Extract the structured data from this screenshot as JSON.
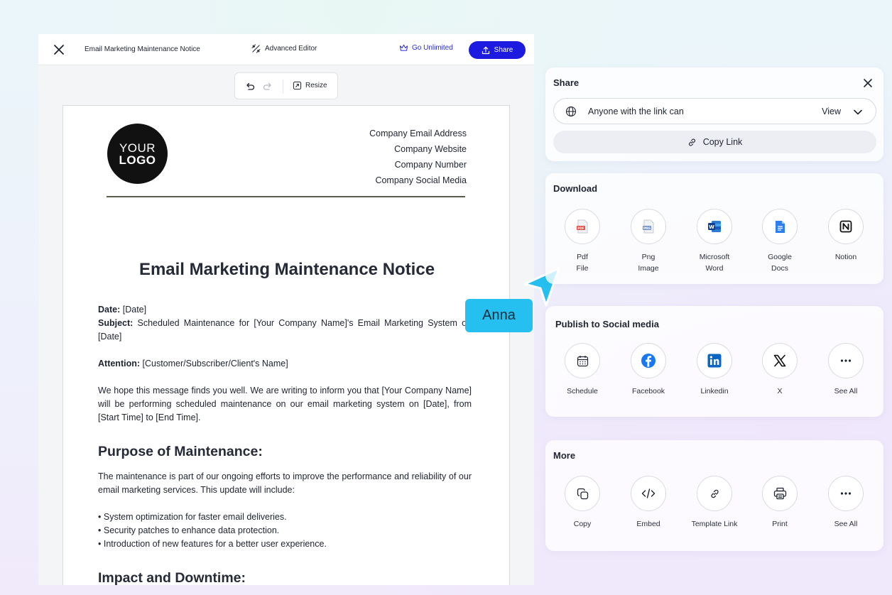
{
  "editor": {
    "doc_title": "Email Marketing Maintenance Notice",
    "advanced_editor": "Advanced Editor",
    "go_unlimited": "Go Unlimited",
    "share": "Share",
    "resize": "Resize",
    "accent_color": "#1d1be0"
  },
  "document": {
    "logo_line1": "YOUR",
    "logo_line2": "LOGO",
    "contact": [
      "Company Email Address",
      "Company Website",
      "Company Number",
      "Company Social Media"
    ],
    "heading": "Email Marketing Maintenance Notice",
    "date_label": "Date:",
    "date_value": " [Date]",
    "subject_label": "Subject:",
    "subject_value": " Scheduled Maintenance for [Your Company Name]'s Email Marketing System on [Date]",
    "attention_label": "Attention:",
    "attention_value": " [Customer/Subscriber/Client's Name]",
    "intro": "We hope this message finds you well. We are writing to inform you that [Your Company Name] will be performing scheduled maintenance on our email marketing system on [Date], from [Start Time] to [End Time].",
    "purpose_heading": "Purpose of Maintenance:",
    "purpose_text": "The maintenance is part of our ongoing efforts to improve the performance and reliability of our email marketing services. This update will include:",
    "bullets": [
      "System optimization for faster email deliveries.",
      "Security patches to enhance data protection.",
      "Introduction of new features for a better user experience."
    ],
    "impact_heading": "Impact and Downtime:"
  },
  "collaborator": {
    "name": "Anna",
    "color": "#25bff0"
  },
  "share_panel": {
    "title": "Share",
    "access_text": "Anyone with the link can",
    "access_role": "View",
    "copy_link": "Copy Link"
  },
  "download": {
    "title": "Download",
    "items": [
      {
        "icon": "pdf-file-icon",
        "line1": "Pdf",
        "line2": "File"
      },
      {
        "icon": "png-image-icon",
        "line1": "Png",
        "line2": "Image"
      },
      {
        "icon": "microsoft-word-icon",
        "line1": "Microsoft",
        "line2": "Word"
      },
      {
        "icon": "google-docs-icon",
        "line1": "Google",
        "line2": "Docs"
      },
      {
        "icon": "notion-icon",
        "line1": "Notion",
        "line2": ""
      }
    ]
  },
  "social": {
    "title": "Publish to Social media",
    "items": [
      {
        "icon": "calendar-icon",
        "label": "Schedule"
      },
      {
        "icon": "facebook-icon",
        "label": "Facebook"
      },
      {
        "icon": "linkedin-icon",
        "label": "Linkedin"
      },
      {
        "icon": "x-icon",
        "label": "X"
      },
      {
        "icon": "more-icon",
        "label": "See All"
      }
    ]
  },
  "more": {
    "title": "More",
    "items": [
      {
        "icon": "copy-icon",
        "label": "Copy"
      },
      {
        "icon": "embed-icon",
        "label": "Embed"
      },
      {
        "icon": "link-icon",
        "label": "Template Link"
      },
      {
        "icon": "print-icon",
        "label": "Print"
      },
      {
        "icon": "more-icon",
        "label": "See All"
      }
    ]
  }
}
